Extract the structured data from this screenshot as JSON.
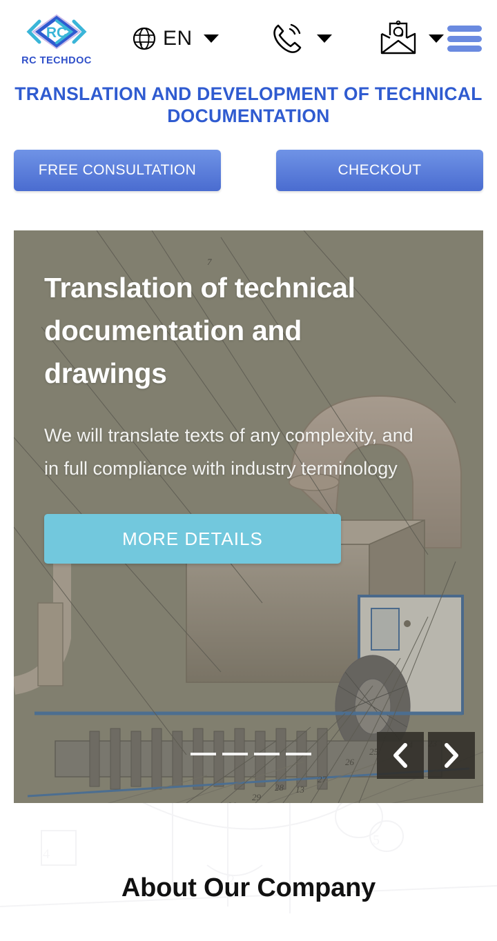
{
  "header": {
    "logo": {
      "mark_icon": "rc-diamond-logo-icon",
      "wordmark": "RC TECHDOC",
      "color": "#2f4fc9"
    },
    "language": {
      "icon": "globe-icon",
      "value": "EN",
      "caret_icon": "caret-down-icon"
    },
    "phone": {
      "icon": "phone-ringing-icon",
      "caret_icon": "caret-down-icon"
    },
    "email": {
      "icon": "envelope-at-icon",
      "caret_icon": "caret-down-icon"
    },
    "menu": {
      "icon": "hamburger-menu-icon",
      "color": "#6a8ae0"
    }
  },
  "page": {
    "title": "TRANSLATION AND DEVELOPMENT OF TECHNICAL DOCUMENTATION",
    "title_color": "#2f5bd0"
  },
  "cta": {
    "primary_label": "FREE CONSULTATION",
    "secondary_label": "CHECKOUT",
    "color": "#4a6cd0"
  },
  "hero": {
    "title": "Translation of technical documentation and drawings",
    "subtitle": "We will translate texts of any complexity, and in full compliance with industry terminology",
    "button_label": "MORE DETAILS",
    "button_color": "#72c8dd",
    "image_description": "technical cad drawing of industrial turbine machinery",
    "slides_total": 4,
    "active_slide": 1,
    "prev_icon": "chevron-left-icon",
    "next_icon": "chevron-right-icon"
  },
  "about": {
    "title": "About Our Company",
    "watermark_description": "faint technical blueprint watermark"
  }
}
